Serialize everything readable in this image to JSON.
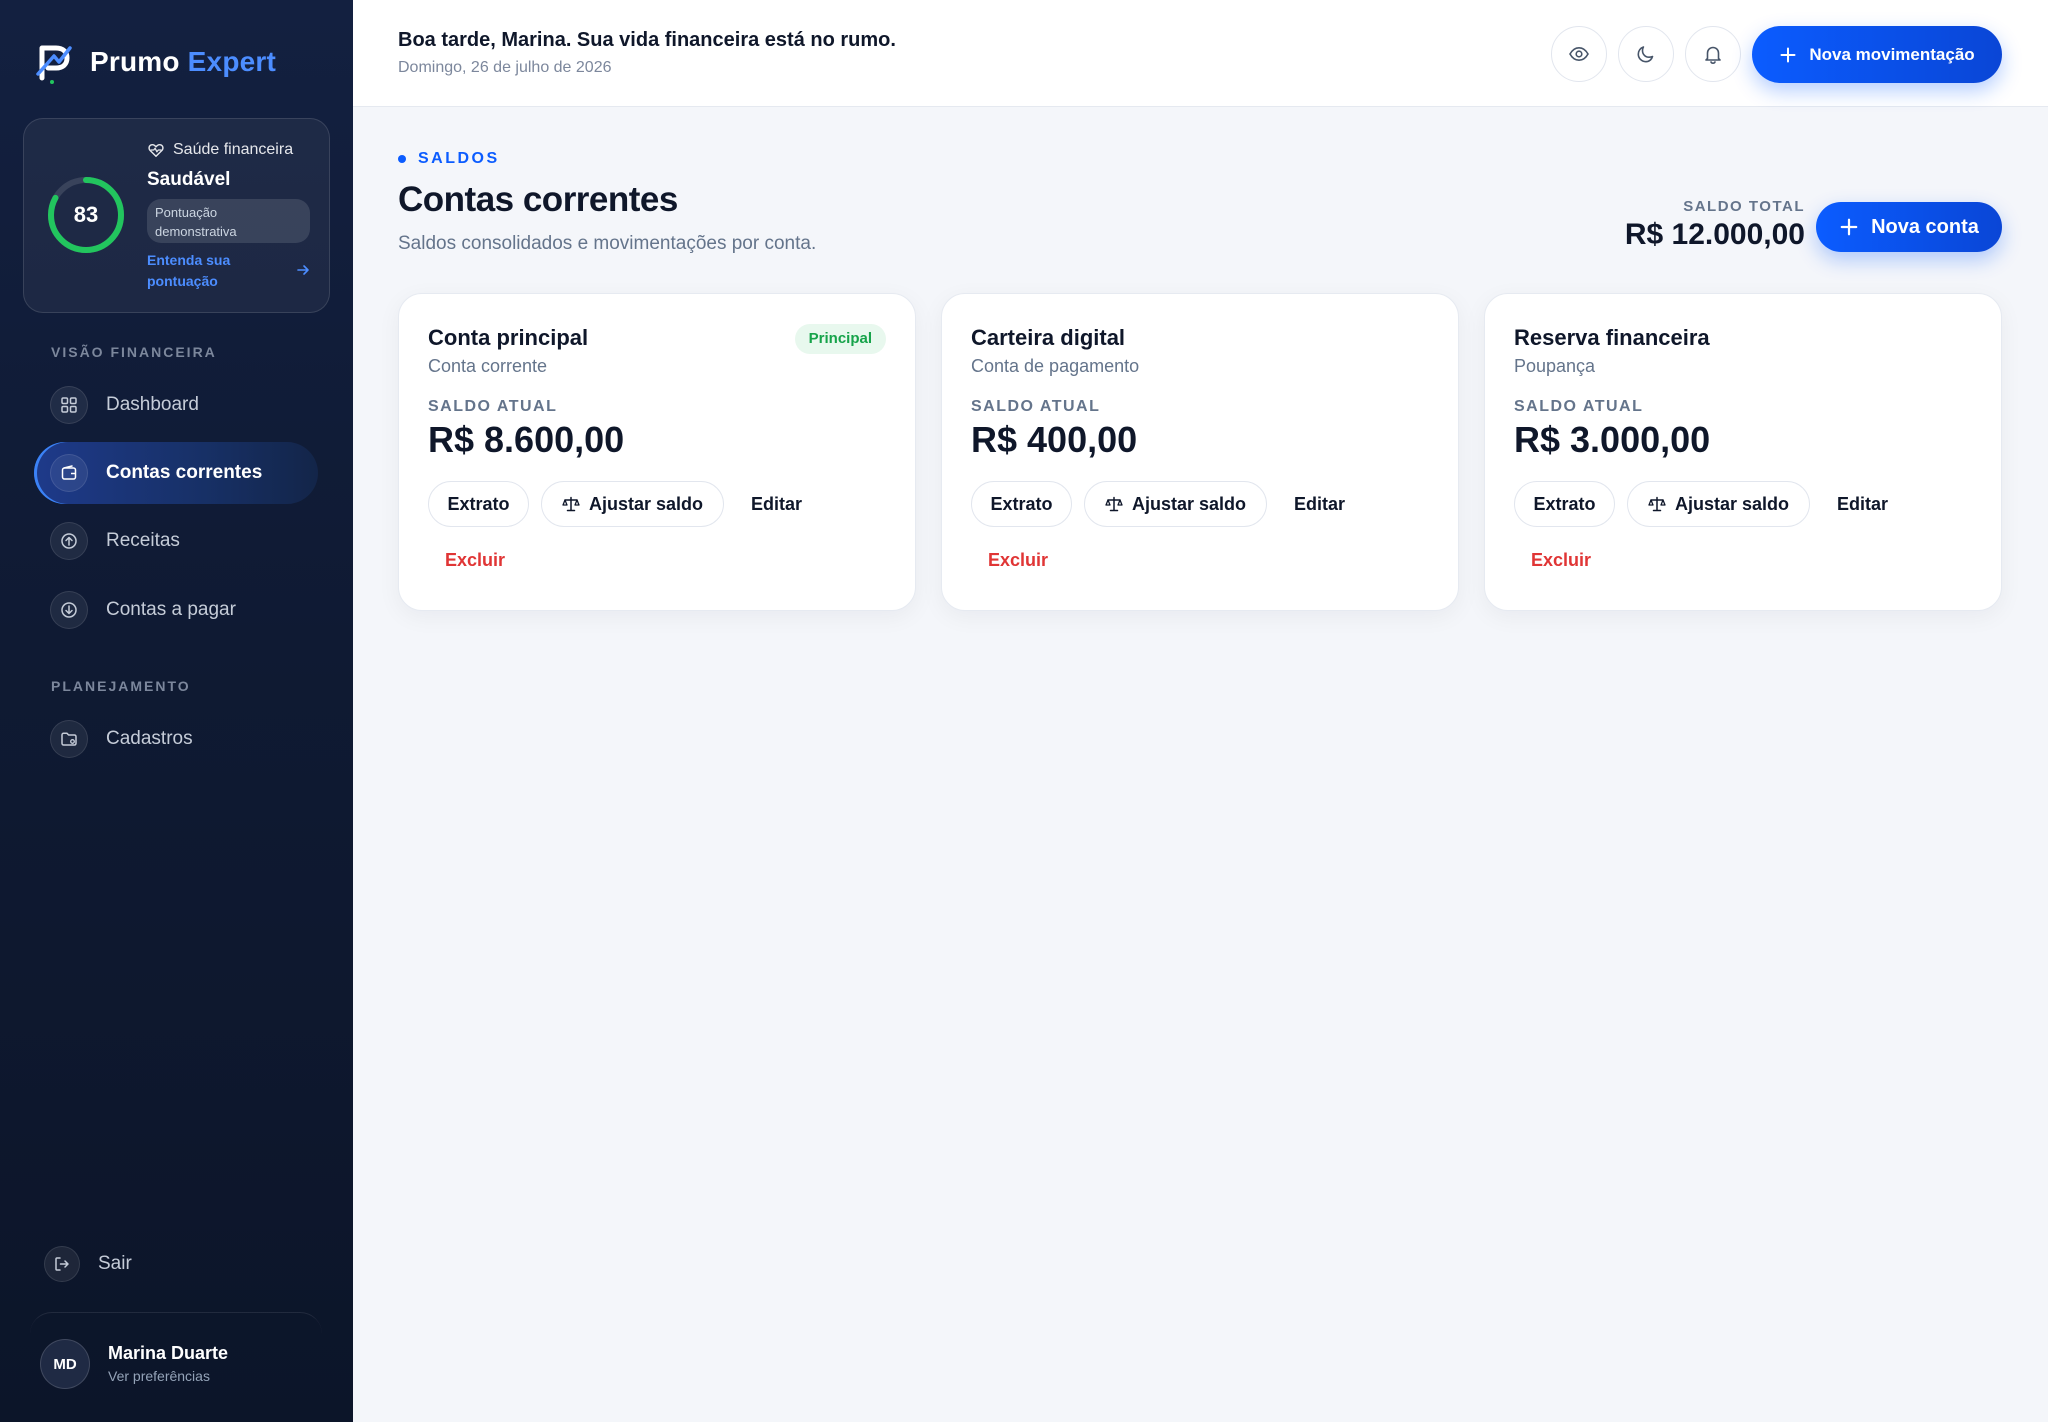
{
  "brand": {
    "name": "Prumo",
    "accent": "Expert"
  },
  "health": {
    "label": "Saúde financeira",
    "status": "Saudável",
    "score": "83",
    "score_fraction": 0.83,
    "badge": "Pontuação demonstrativa",
    "link": "Entenda sua pontuação"
  },
  "sidebar": {
    "section_financial": "VISÃO FINANCEIRA",
    "section_planning": "PLANEJAMENTO",
    "items": [
      {
        "label": "Dashboard",
        "icon": "grid-icon"
      },
      {
        "label": "Contas correntes",
        "icon": "wallet-icon",
        "active": true
      },
      {
        "label": "Receitas",
        "icon": "arrow-up-circle-icon"
      },
      {
        "label": "Contas a pagar",
        "icon": "arrow-down-circle-icon"
      },
      {
        "label": "Cadastros",
        "icon": "folder-settings-icon"
      }
    ],
    "logout": "Sair"
  },
  "user": {
    "initials": "MD",
    "name": "Marina Duarte",
    "sub": "Ver preferências"
  },
  "header": {
    "greeting": "Boa tarde, Marina. Sua vida financeira está no rumo.",
    "date": "Domingo, 26 de julho de 2026",
    "new_transaction": "Nova movimentação"
  },
  "page": {
    "eyebrow": "SALDOS",
    "title": "Contas correntes",
    "subtitle": "Saldos consolidados e movimentações por conta.",
    "total_label": "SALDO TOTAL",
    "total_value": "R$ 12.000,00",
    "new_account": "Nova conta"
  },
  "accounts": [
    {
      "name": "Conta principal",
      "type": "Conta corrente",
      "badge": "Principal",
      "balance_label": "SALDO ATUAL",
      "balance": "R$ 8.600,00"
    },
    {
      "name": "Carteira digital",
      "type": "Conta de pagamento",
      "badge": "",
      "balance_label": "SALDO ATUAL",
      "balance": "R$ 400,00"
    },
    {
      "name": "Reserva financeira",
      "type": "Poupança",
      "badge": "",
      "balance_label": "SALDO ATUAL",
      "balance": "R$ 3.000,00"
    }
  ],
  "actions": {
    "statement": "Extrato",
    "adjust": "Ajustar saldo",
    "edit": "Editar",
    "delete": "Excluir"
  },
  "colors": {
    "accent": "#0b5cff",
    "success": "#16a34a",
    "danger": "#e03535",
    "sidebar": "#0f1a33"
  }
}
